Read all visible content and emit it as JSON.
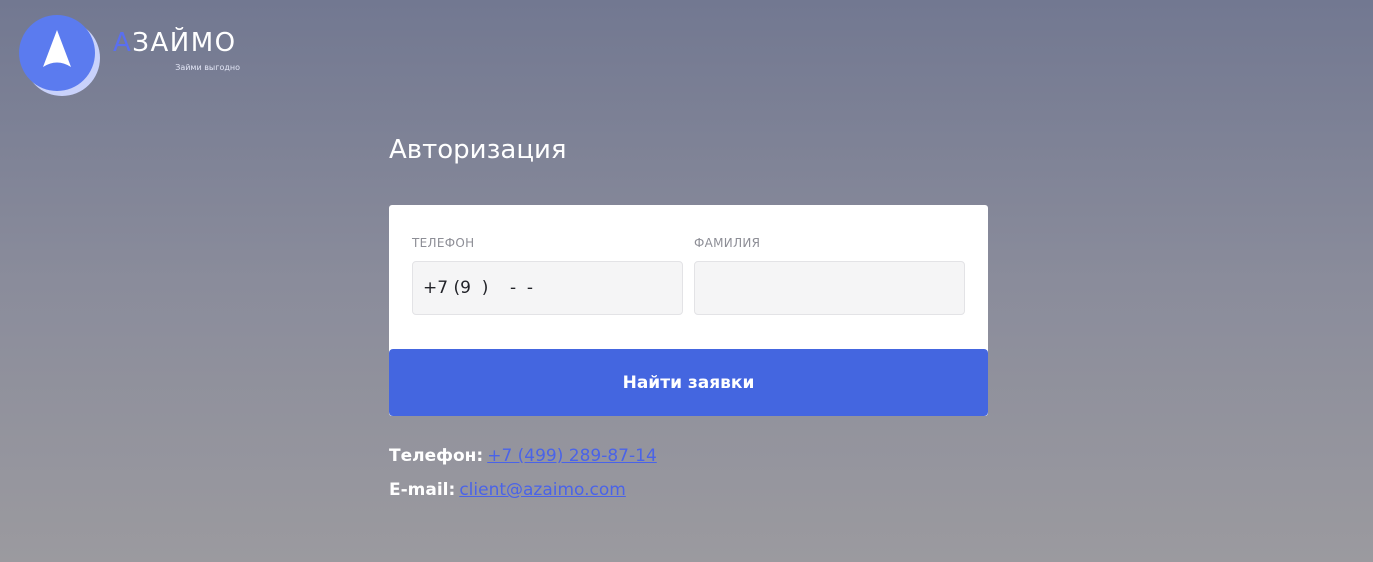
{
  "brand": {
    "name_accent": "А",
    "name_rest": "ЗАЙМО",
    "tagline": "Займи выгодно",
    "logo_icon": "rocket-logo-icon",
    "colors": {
      "accent": "#5a6ff0",
      "logo_front": "#5b7bef",
      "logo_back": "#c9d2fb"
    }
  },
  "page": {
    "title": "Авторизация"
  },
  "form": {
    "phone": {
      "label": "Телефон",
      "value": "+7 (9  )    -  -",
      "placeholder": ""
    },
    "surname": {
      "label": "Фамилия",
      "value": "",
      "placeholder": ""
    },
    "submit_label": "Найти заявки",
    "colors": {
      "button": "#4466e0"
    }
  },
  "contacts": {
    "phone_label": "Телефон:",
    "phone_value": "+7 (499) 289-87-14",
    "email_label": "E-mail:",
    "email_value": "client@azaimo.com",
    "colors": {
      "link": "#4a63e8"
    }
  }
}
